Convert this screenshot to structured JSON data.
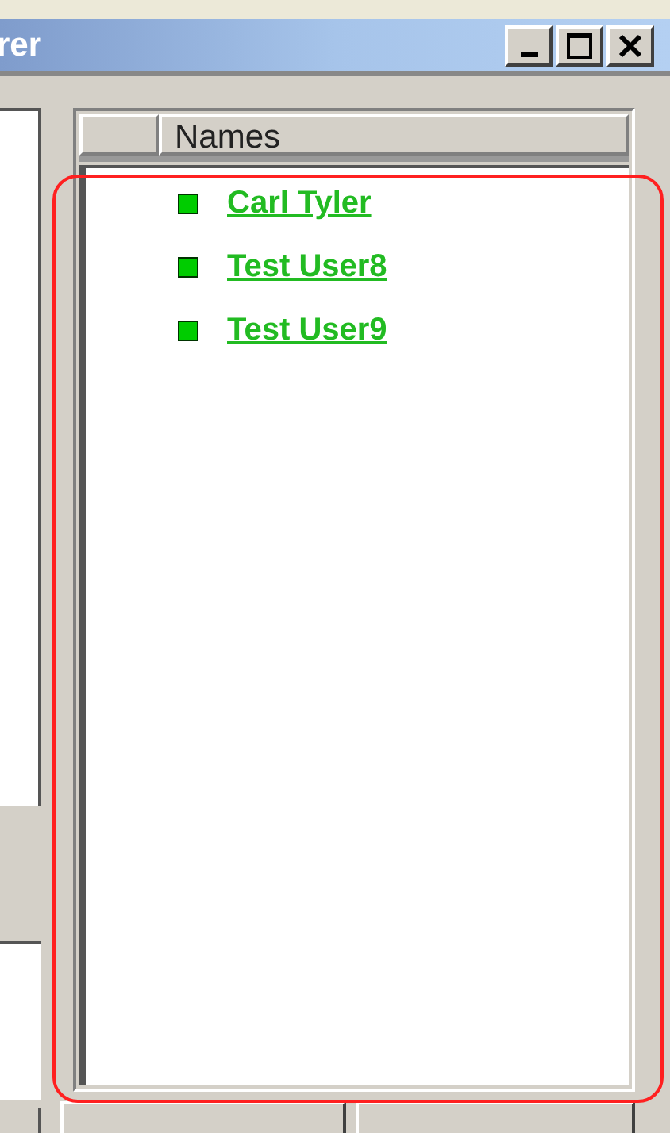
{
  "window": {
    "title": "rer"
  },
  "list": {
    "columns": [
      "Names"
    ],
    "items": [
      {
        "name": "Carl Tyler",
        "color": "#00cc00"
      },
      {
        "name": "Test User8",
        "color": "#00cc00"
      },
      {
        "name": "Test User9",
        "color": "#00cc00"
      }
    ]
  }
}
